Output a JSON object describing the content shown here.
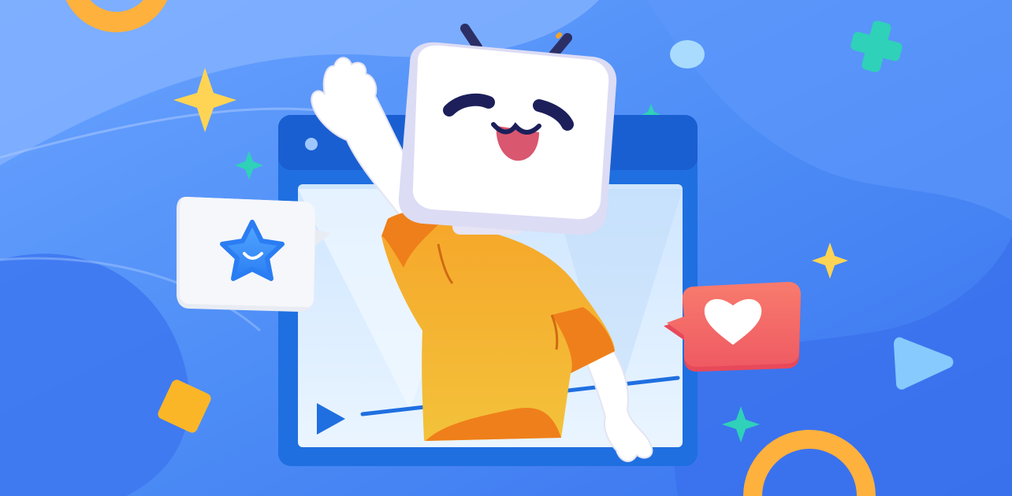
{
  "scene": {
    "palette": {
      "background": "#4a8cf7",
      "background_light": "#8fb8ff",
      "background_deep": "#3f74f0",
      "window_frame": "#1f6fe0",
      "window_screen": "#d6eaff",
      "tv_head": "#ffffff",
      "tv_antenna": "#2c2f66",
      "shirt": "#f4a229",
      "shirt_shadow": "#ef7f1a",
      "star_bubble": "#e9ecf3",
      "star_icon": "#3b8bff",
      "heart_bubble": "#f36a6a",
      "heart_icon": "#ffffff",
      "sparkle_yellow": "#ffd454",
      "sparkle_teal": "#2fd1b8",
      "ring_orange": "#ffb13d",
      "play_triangle": "#8fd4ff"
    },
    "icons": {
      "mascot": "tv-head-mascot-icon",
      "video_window": "video-player-window-icon",
      "star_bubble": "star-chat-bubble-icon",
      "heart_bubble": "heart-chat-bubble-icon",
      "play_button": "play-icon",
      "cross": "plus-cross-icon",
      "ring": "ring-icon",
      "square": "diamond-square-icon",
      "sparkle": "sparkle-icon"
    }
  }
}
